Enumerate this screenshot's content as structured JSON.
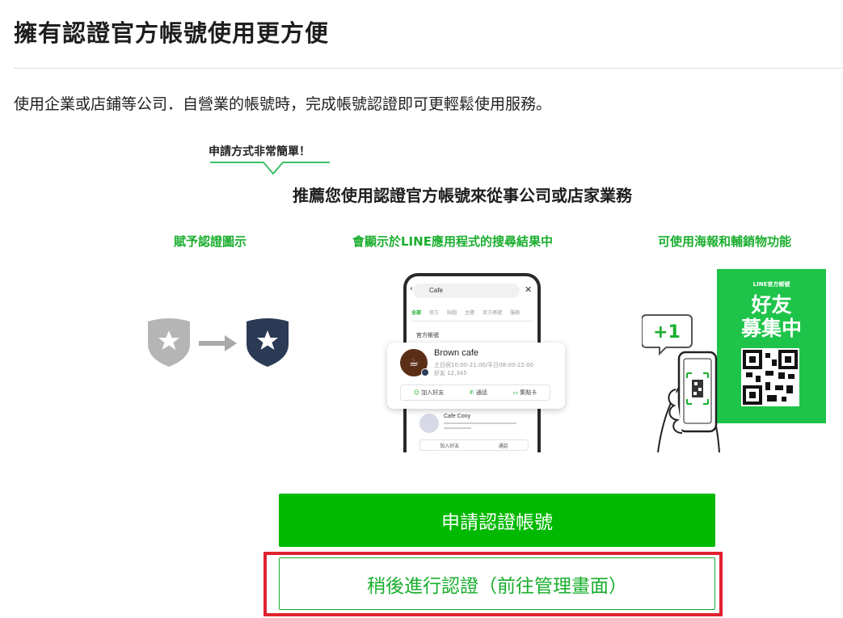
{
  "heading": "擁有認證官方帳號使用更方便",
  "description": "使用企業或店鋪等公司．自營業的帳號時，完成帳號認證即可更輕鬆使用服務。",
  "illustration": {
    "bubble_text": "申請方式非常簡單！",
    "headline": "推薦您使用認證官方帳號來從事公司或店家業務",
    "features": [
      "賦予認證圖示",
      "會顯示於LINE應用程式的搜尋結果中",
      "可使用海報和輔銷物功能"
    ],
    "phone": {
      "search_text": "Cafe",
      "tabs": [
        "全部",
        "官方",
        "貼圖",
        "主題",
        "官方帳號",
        "服務"
      ],
      "section_label": "官方帳號",
      "card": {
        "name": "Brown cafe",
        "hours": "土日祝10:00-21:00/平日08:00-22:00",
        "friends": "好友 12,345",
        "actions": [
          "加入好友",
          "通話",
          "集點卡"
        ]
      },
      "second": {
        "name": "Cafe Cony",
        "friends": "好友 1,234",
        "actions": [
          "加入好友",
          "通話"
        ]
      }
    },
    "poster": {
      "small_text": "LINE官方帳號",
      "big_text_1": "好友",
      "big_text_2": "募集中"
    },
    "plus_badge": "+1"
  },
  "buttons": {
    "apply": "申請認證帳號",
    "later": "稍後進行認證（前往管理畫面）"
  },
  "colors": {
    "brand_green": "#00b900",
    "text_green": "#1aae2e",
    "navy": "#2b3a55",
    "highlight_red": "#e0212f"
  }
}
